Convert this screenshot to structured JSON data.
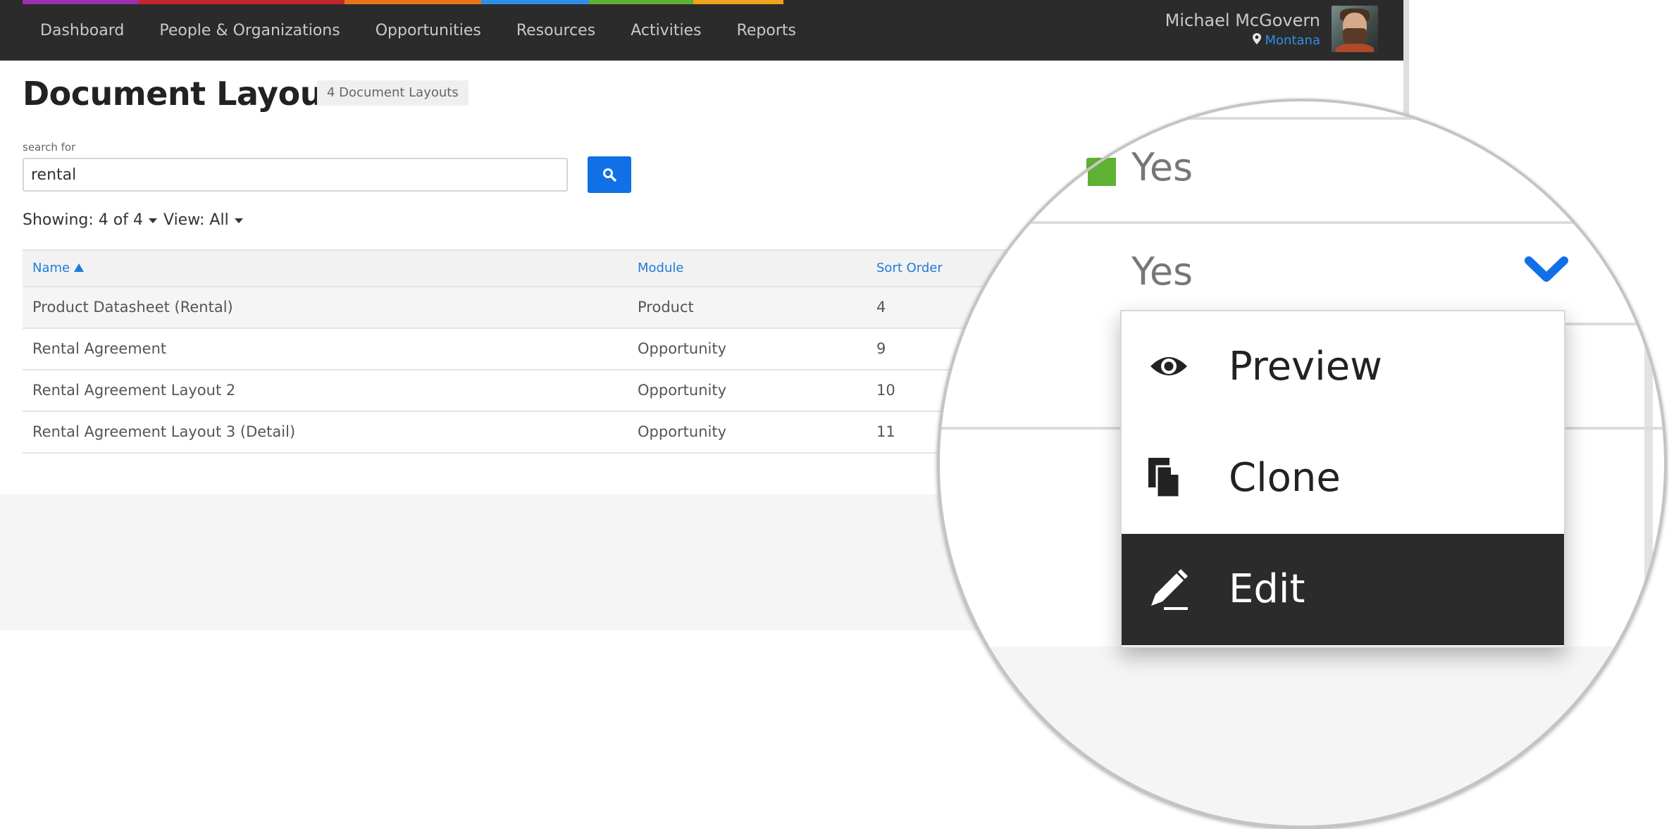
{
  "nav": {
    "items": [
      "Dashboard",
      "People & Organizations",
      "Opportunities",
      "Resources",
      "Activities",
      "Reports"
    ],
    "accent_colors": [
      "#9b2fae",
      "#c0282e",
      "#e8751a",
      "#2f8fe8",
      "#5fb133",
      "#f0a21b"
    ]
  },
  "user": {
    "name": "Michael McGovern",
    "location": "Montana"
  },
  "page": {
    "title": "Document Layouts",
    "count_badge": "4 Document Layouts"
  },
  "search": {
    "label": "search for",
    "value": "rental"
  },
  "filters": {
    "showing": "Showing: 4 of 4",
    "view": "View: All"
  },
  "table": {
    "headers": {
      "name": "Name",
      "module": "Module",
      "sort_order": "Sort Order"
    },
    "rows": [
      {
        "name": "Product Datasheet (Rental)",
        "module": "Product",
        "sort_order": "4"
      },
      {
        "name": "Rental Agreement",
        "module": "Opportunity",
        "sort_order": "9"
      },
      {
        "name": "Rental Agreement Layout 2",
        "module": "Opportunity",
        "sort_order": "10"
      },
      {
        "name": "Rental Agreement Layout 3 (Detail)",
        "module": "Opportunity",
        "sort_order": "11"
      }
    ]
  },
  "zoom": {
    "values": [
      "Yes",
      "Yes"
    ],
    "menu": [
      {
        "label": "Preview",
        "icon": "eye-icon"
      },
      {
        "label": "Clone",
        "icon": "clone-icon"
      },
      {
        "label": "Edit",
        "icon": "pencil-icon"
      }
    ]
  },
  "colors": {
    "nav_bg": "#2b2b2b",
    "link_blue": "#1e7bd8",
    "button_blue": "#1170e6",
    "active_menu_bg": "#2b2b2b"
  }
}
